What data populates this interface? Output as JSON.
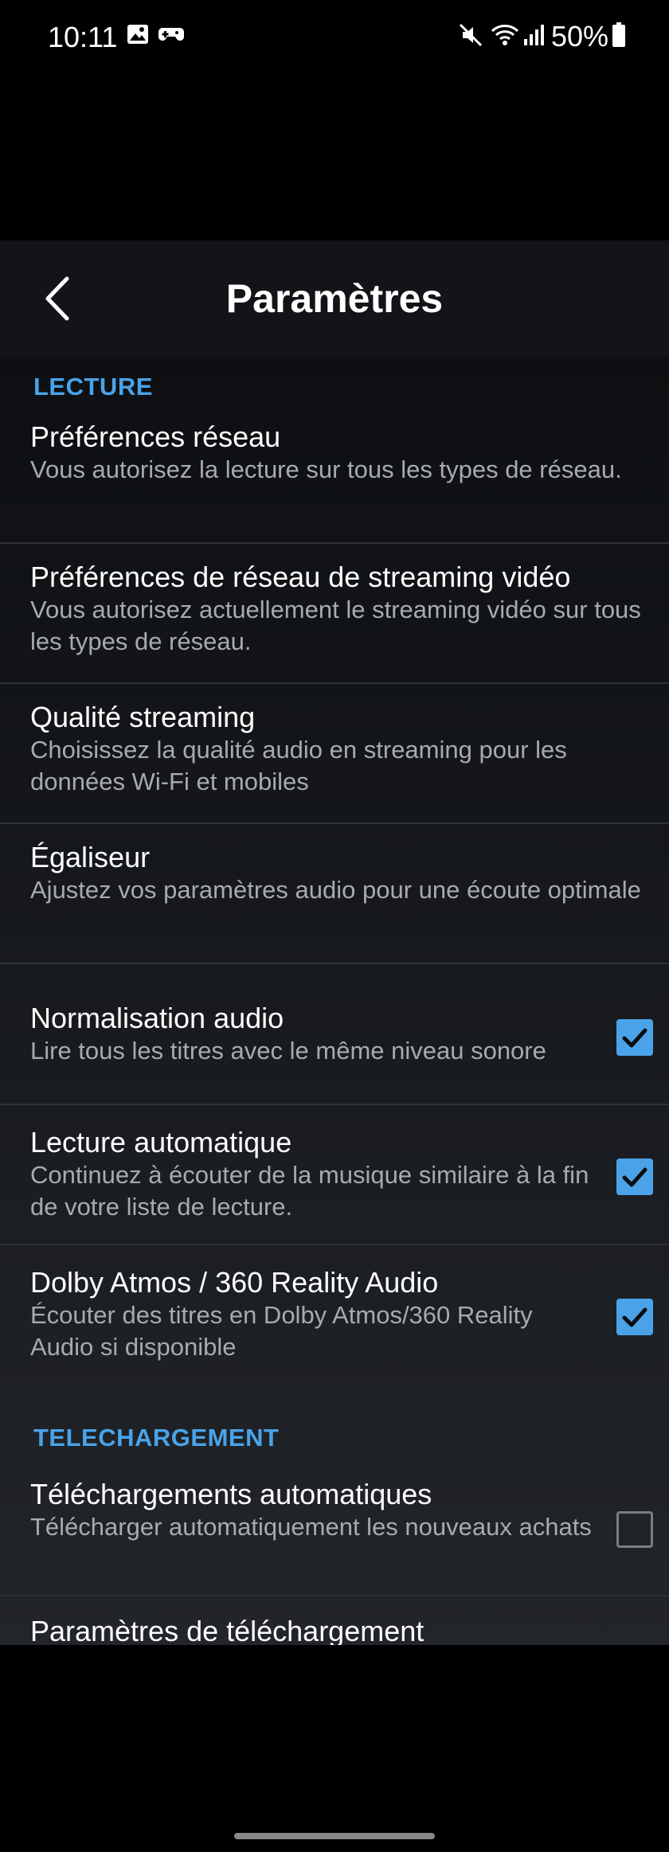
{
  "status_bar": {
    "time": "10:11",
    "battery": "50%",
    "icons": [
      "gallery-icon",
      "game-icon",
      "mute-icon",
      "wifi-icon",
      "signal-icon",
      "battery-icon"
    ]
  },
  "app_bar": {
    "title": "Paramètres",
    "back_icon": "chevron-left-icon"
  },
  "sections": [
    {
      "header": "LECTURE",
      "items": [
        {
          "title": "Préférences réseau",
          "subtitle": "Vous autorisez la lecture sur tous les types de réseau."
        },
        {
          "title": "Préférences de réseau de streaming vidéo",
          "subtitle": "Vous autorisez actuellement le streaming vidéo sur tous les types de réseau."
        },
        {
          "title": "Qualité streaming",
          "subtitle": "Choisissez la qualité audio en streaming pour les données Wi-Fi et mobiles"
        },
        {
          "title": "Égaliseur",
          "subtitle": "Ajustez vos paramètres audio pour une écoute optimale"
        },
        {
          "title": "Normalisation audio",
          "subtitle": "Lire tous les titres avec le même niveau sonore",
          "checked": true
        },
        {
          "title": "Lecture automatique",
          "subtitle": "Continuez à écouter de la musique similaire à la fin de votre liste de lecture.",
          "checked": true
        },
        {
          "title": "Dolby Atmos / 360 Reality Audio",
          "subtitle": "Écouter des titres en Dolby Atmos/360 Reality Audio si disponible",
          "checked": true
        }
      ]
    },
    {
      "header": "TELECHARGEMENT",
      "items": [
        {
          "title": "Téléchargements automatiques",
          "subtitle": "Télécharger automatiquement les nouveaux achats",
          "checked": false
        },
        {
          "title": "Paramètres de téléchargement"
        }
      ]
    }
  ],
  "colors": {
    "accent": "#4aa3e8",
    "background": "#000000",
    "app_bar": "#121418",
    "subtitle_text": "#a7aaaf"
  }
}
